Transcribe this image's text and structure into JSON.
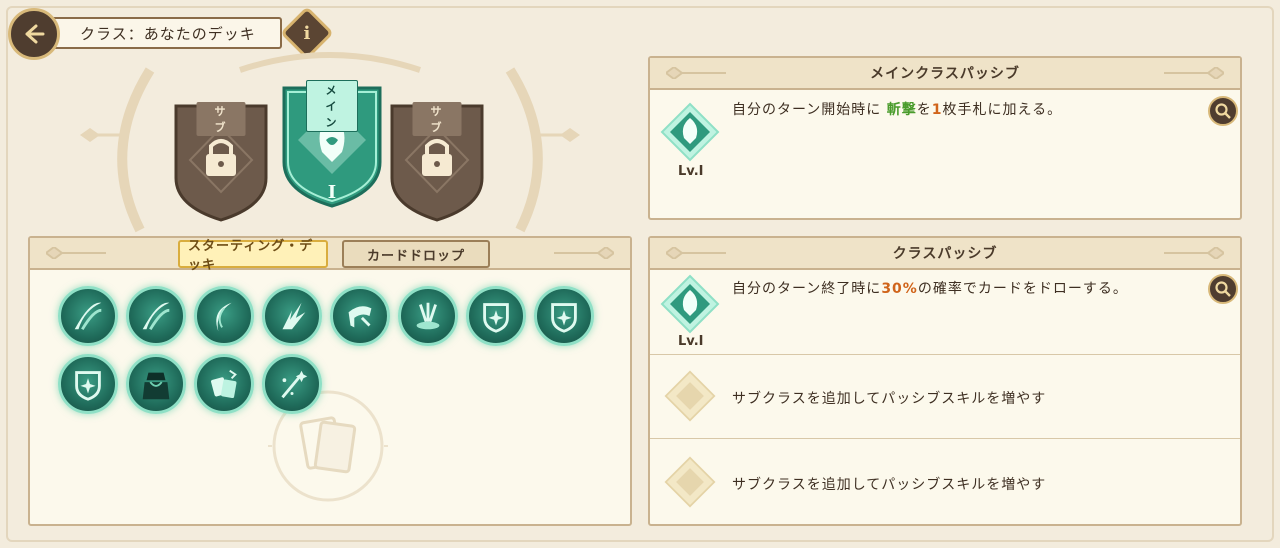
{
  "header": {
    "title": "クラス：あなたのデッキ",
    "info_label": "i"
  },
  "crest": {
    "left": {
      "tag": "サブ",
      "state": "locked"
    },
    "main": {
      "tag": "メイン",
      "rank": "I"
    },
    "right": {
      "tag": "サブ",
      "state": "locked"
    }
  },
  "deck_panel": {
    "tabs": [
      {
        "label": "スターティング・デッキ",
        "active": true
      },
      {
        "label": "カードドロップ",
        "active": false
      }
    ],
    "cards": [
      {
        "icon": "slash-icon"
      },
      {
        "icon": "slash-icon"
      },
      {
        "icon": "crescent-slash-icon"
      },
      {
        "icon": "shatter-icon"
      },
      {
        "icon": "swipe-icon"
      },
      {
        "icon": "cleave-icon"
      },
      {
        "icon": "shield-sparkle-icon"
      },
      {
        "icon": "shield-sparkle-icon"
      },
      {
        "icon": "shield-sparkle-icon"
      },
      {
        "icon": "cloak-icon"
      },
      {
        "icon": "card-draw-icon"
      },
      {
        "icon": "wand-sparkle-icon"
      }
    ]
  },
  "main_passive": {
    "title": "メインクラスパッシブ",
    "level": "Lv.I",
    "text_pre": "自分のターン開始時に ",
    "keyword": "斬撃",
    "text_mid": "を",
    "count": "1",
    "text_post": "枚手札に加える。"
  },
  "class_passive": {
    "title": "クラスパッシブ",
    "level": "Lv.I",
    "text_pre": "自分のターン終了時に",
    "percent": "30%",
    "text_post": "の確率でカードをドローする。",
    "empty_slots": [
      {
        "text": "サブクラスを追加してパッシブスキルを増やす"
      },
      {
        "text": "サブクラスを追加してパッシブスキルを増やす"
      }
    ]
  },
  "colors": {
    "accent_green": "#4a9c2c",
    "accent_orange": "#d0641a",
    "teal": "#2f9a7e",
    "brown": "#4f3d2f"
  }
}
